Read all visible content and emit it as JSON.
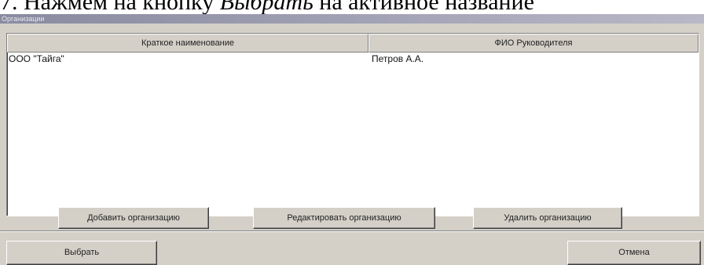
{
  "document": {
    "line_plain_1": "7. Нажмем на кнопку ",
    "line_italic": "Выбрать",
    "line_plain_2": " на активное название"
  },
  "window": {
    "title": "Организации"
  },
  "grid": {
    "columns": [
      "Краткое наименование",
      "ФИО Руководителя"
    ],
    "rows": [
      [
        "ООО \"Тайга\"",
        "Петров А.А."
      ]
    ]
  },
  "buttons": {
    "add": "Добавить организацию",
    "edit": "Редактировать организацию",
    "delete": "Удалить организацию",
    "select": "Выбрать",
    "cancel": "Отмена"
  }
}
